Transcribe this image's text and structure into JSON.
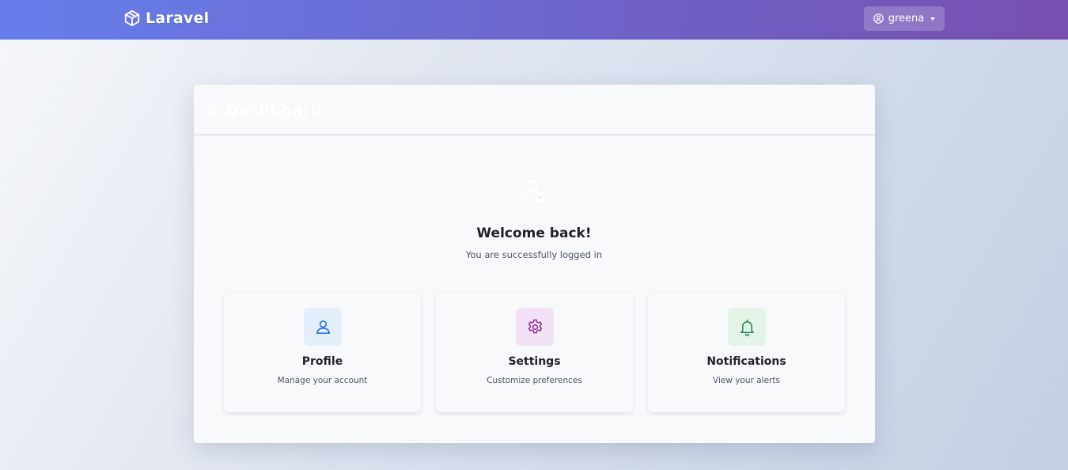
{
  "navbar": {
    "brand": "Laravel",
    "brand_icon": "box-icon",
    "user": {
      "name": "greena",
      "icon": "user-circle-icon",
      "dropdown_icon": "caret-down-icon"
    },
    "gradient": [
      "#667eea",
      "#7650b0"
    ]
  },
  "dashboard": {
    "header": {
      "title": "Dashboard",
      "icon": "speedometer-icon"
    },
    "welcome": {
      "icon": "user-check-icon",
      "title": "Welcome back!",
      "subtitle": "You are successfully logged in"
    },
    "features": [
      {
        "title": "Profile",
        "description": "Manage your account",
        "icon": "person-icon",
        "icon_color": "#1e6fd0",
        "tile_color": "#e3f0fc"
      },
      {
        "title": "Settings",
        "description": "Customize preferences",
        "icon": "gear-icon",
        "icon_color": "#8a2a9b",
        "tile_color": "#f3e2f5"
      },
      {
        "title": "Notifications",
        "description": "View your alerts",
        "icon": "bell-icon",
        "icon_color": "#1f8a4c",
        "tile_color": "#e5f4e9"
      }
    ]
  }
}
